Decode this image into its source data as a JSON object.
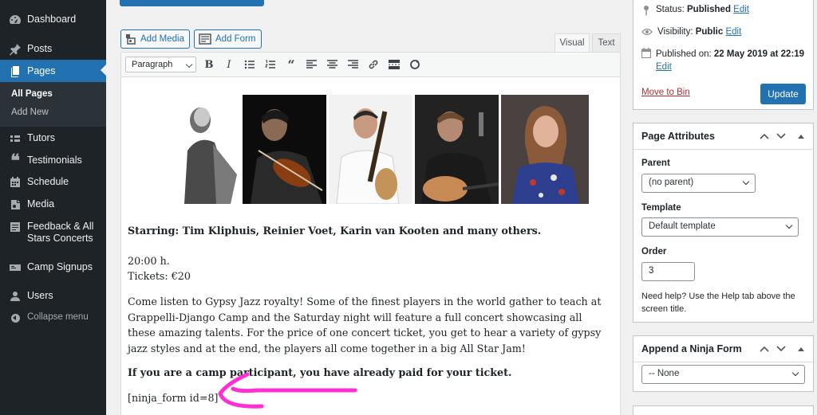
{
  "sidebar": {
    "items": [
      {
        "label": "Dashboard",
        "icon": "dashboard-icon"
      },
      {
        "label": "Posts",
        "icon": "pin-icon"
      },
      {
        "label": "Pages",
        "icon": "pages-icon"
      },
      {
        "label": "Tutors",
        "icon": "tutors-icon"
      },
      {
        "label": "Testimonials",
        "icon": "quote-icon"
      },
      {
        "label": "Schedule",
        "icon": "schedule-icon"
      },
      {
        "label": "Media",
        "icon": "media-icon"
      },
      {
        "label": "Feedback & All Stars Concerts",
        "icon": "feedback-icon"
      },
      {
        "label": "Camp Signups",
        "icon": "signups-icon"
      },
      {
        "label": "Users",
        "icon": "users-icon"
      }
    ],
    "submenu": [
      "All Pages",
      "Add New"
    ],
    "collapse_label": "Collapse menu"
  },
  "editor": {
    "add_media": "Add Media",
    "add_form": "Add Form",
    "tab_visual": "Visual",
    "tab_text": "Text",
    "format_value": "Paragraph",
    "content": {
      "starring": "Starring: Tim Kliphuis, Reinier Voet, Karin van Kooten and many others.",
      "time": "20:00 h.",
      "tickets": "Tickets: €20",
      "desc": "Come listen to Gypsy Jazz royalty! Some of the finest players in the world gather to teach at Grappelli-Django Camp and the Saturday night will feature a full concert showcasing all these amazing talents. For the price of one concert ticket, you get to hear a variety of gypsy jazz styles and at the end, the players all come together in a big All Star Jam!",
      "participant": "If you are a camp participant, you have already paid for your ticket.",
      "shortcode": "[ninja_form id=8]"
    }
  },
  "publish": {
    "status_label": "Status:",
    "status_value": "Published",
    "visibility_label": "Visibility:",
    "visibility_value": "Public",
    "published_label": "Published on:",
    "published_value": "22 May 2019 at 22:19",
    "edit": "Edit",
    "move_to_bin": "Move to Bin",
    "update": "Update"
  },
  "page_attributes": {
    "title": "Page Attributes",
    "parent_label": "Parent",
    "parent_value": "(no parent)",
    "template_label": "Template",
    "template_value": "Default template",
    "order_label": "Order",
    "order_value": "3",
    "help": "Need help? Use the Help tab above the screen title."
  },
  "ninja": {
    "title": "Append a Ninja Form",
    "value": "-- None"
  },
  "colors": {
    "sidebar_bg": "#1d2327",
    "accent": "#2271b1",
    "annotation": "#ff2fd6",
    "danger": "#b32d2e"
  }
}
